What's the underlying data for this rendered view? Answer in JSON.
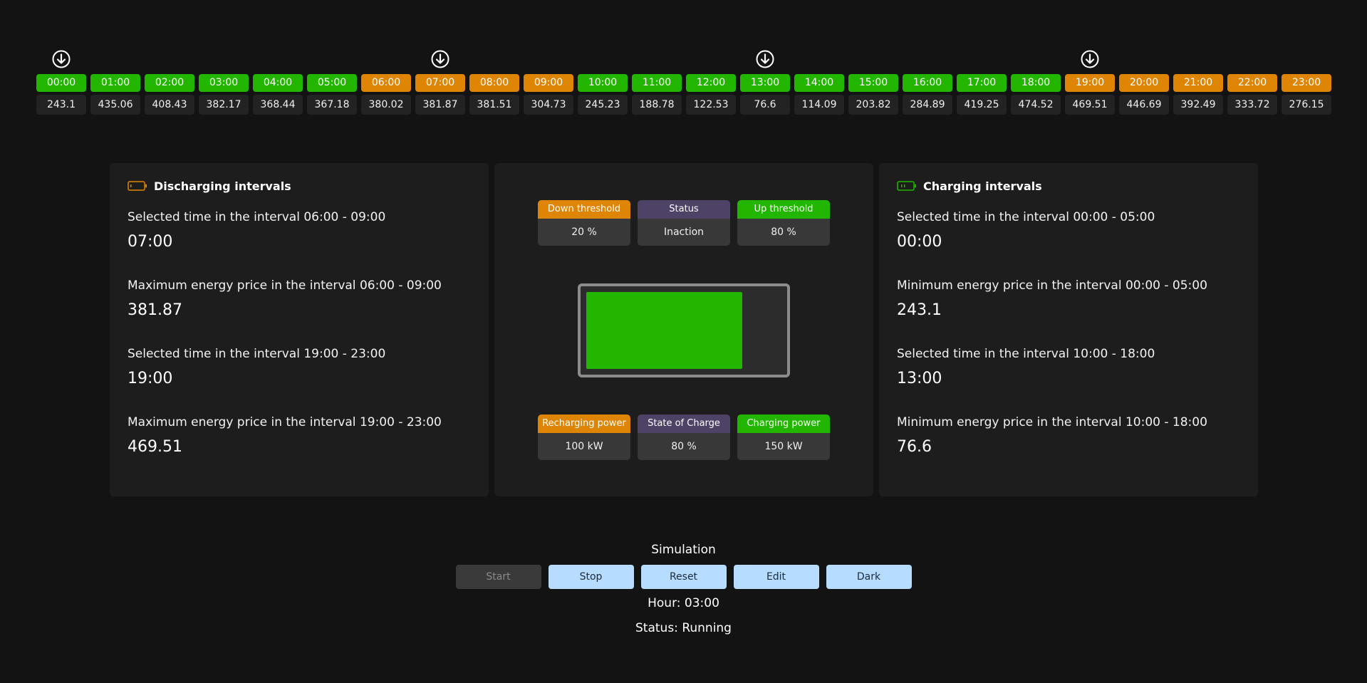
{
  "colors": {
    "charging": "#22b600",
    "discharging": "#df8505",
    "status": "#4e4267",
    "button": "#b6dcff",
    "button_disabled": "#3a3a3a"
  },
  "timeline": [
    {
      "hour": "00:00",
      "price": "243.1",
      "mode": "charging",
      "marker": true
    },
    {
      "hour": "01:00",
      "price": "435.06",
      "mode": "charging",
      "marker": false
    },
    {
      "hour": "02:00",
      "price": "408.43",
      "mode": "charging",
      "marker": false
    },
    {
      "hour": "03:00",
      "price": "382.17",
      "mode": "charging",
      "marker": false
    },
    {
      "hour": "04:00",
      "price": "368.44",
      "mode": "charging",
      "marker": false
    },
    {
      "hour": "05:00",
      "price": "367.18",
      "mode": "charging",
      "marker": false
    },
    {
      "hour": "06:00",
      "price": "380.02",
      "mode": "discharging",
      "marker": false
    },
    {
      "hour": "07:00",
      "price": "381.87",
      "mode": "discharging",
      "marker": true
    },
    {
      "hour": "08:00",
      "price": "381.51",
      "mode": "discharging",
      "marker": false
    },
    {
      "hour": "09:00",
      "price": "304.73",
      "mode": "discharging",
      "marker": false
    },
    {
      "hour": "10:00",
      "price": "245.23",
      "mode": "charging",
      "marker": false
    },
    {
      "hour": "11:00",
      "price": "188.78",
      "mode": "charging",
      "marker": false
    },
    {
      "hour": "12:00",
      "price": "122.53",
      "mode": "charging",
      "marker": false
    },
    {
      "hour": "13:00",
      "price": "76.6",
      "mode": "charging",
      "marker": true
    },
    {
      "hour": "14:00",
      "price": "114.09",
      "mode": "charging",
      "marker": false
    },
    {
      "hour": "15:00",
      "price": "203.82",
      "mode": "charging",
      "marker": false
    },
    {
      "hour": "16:00",
      "price": "284.89",
      "mode": "charging",
      "marker": false
    },
    {
      "hour": "17:00",
      "price": "419.25",
      "mode": "charging",
      "marker": false
    },
    {
      "hour": "18:00",
      "price": "474.52",
      "mode": "charging",
      "marker": false
    },
    {
      "hour": "19:00",
      "price": "469.51",
      "mode": "discharging",
      "marker": true
    },
    {
      "hour": "20:00",
      "price": "446.69",
      "mode": "discharging",
      "marker": false
    },
    {
      "hour": "21:00",
      "price": "392.49",
      "mode": "discharging",
      "marker": false
    },
    {
      "hour": "22:00",
      "price": "333.72",
      "mode": "discharging",
      "marker": false
    },
    {
      "hour": "23:00",
      "price": "276.15",
      "mode": "discharging",
      "marker": false
    }
  ],
  "discharging": {
    "icon": "battery-empty-icon",
    "title": "Discharging intervals",
    "items": [
      {
        "label": "Selected time in the interval 06:00 - 09:00",
        "value": "07:00"
      },
      {
        "label": "Maximum energy price in the interval 06:00 - 09:00",
        "value": "381.87"
      },
      {
        "label": "Selected time in the interval 19:00 - 23:00",
        "value": "19:00"
      },
      {
        "label": "Maximum energy price in the interval 19:00 - 23:00",
        "value": "469.51"
      }
    ]
  },
  "charging": {
    "icon": "battery-charging-icon",
    "title": "Charging intervals",
    "items": [
      {
        "label": "Selected time in the interval 00:00 - 05:00",
        "value": "00:00"
      },
      {
        "label": "Minimum energy price in the interval 00:00 - 05:00",
        "value": "243.1"
      },
      {
        "label": "Selected time in the interval 10:00 - 18:00",
        "value": "13:00"
      },
      {
        "label": "Minimum energy price in the interval 10:00 - 18:00",
        "value": "76.6"
      }
    ]
  },
  "center": {
    "top": [
      {
        "label": "Down threshold",
        "value": "20 %",
        "color": "#df8505"
      },
      {
        "label": "Status",
        "value": "Inaction",
        "color": "#4e4267"
      },
      {
        "label": "Up threshold",
        "value": "80 %",
        "color": "#22b600"
      }
    ],
    "bottom": [
      {
        "label": "Recharging power",
        "value": "100 kW",
        "color": "#df8505"
      },
      {
        "label": "State of Charge",
        "value": "80 %",
        "color": "#4e4267"
      },
      {
        "label": "Charging power",
        "value": "150 kW",
        "color": "#22b600"
      }
    ],
    "battery_level": 0.8
  },
  "simulation": {
    "title": "Simulation",
    "buttons": {
      "start": "Start",
      "stop": "Stop",
      "reset": "Reset",
      "edit": "Edit",
      "dark": "Dark"
    },
    "hour": "Hour: 03:00",
    "status": "Status: Running"
  }
}
